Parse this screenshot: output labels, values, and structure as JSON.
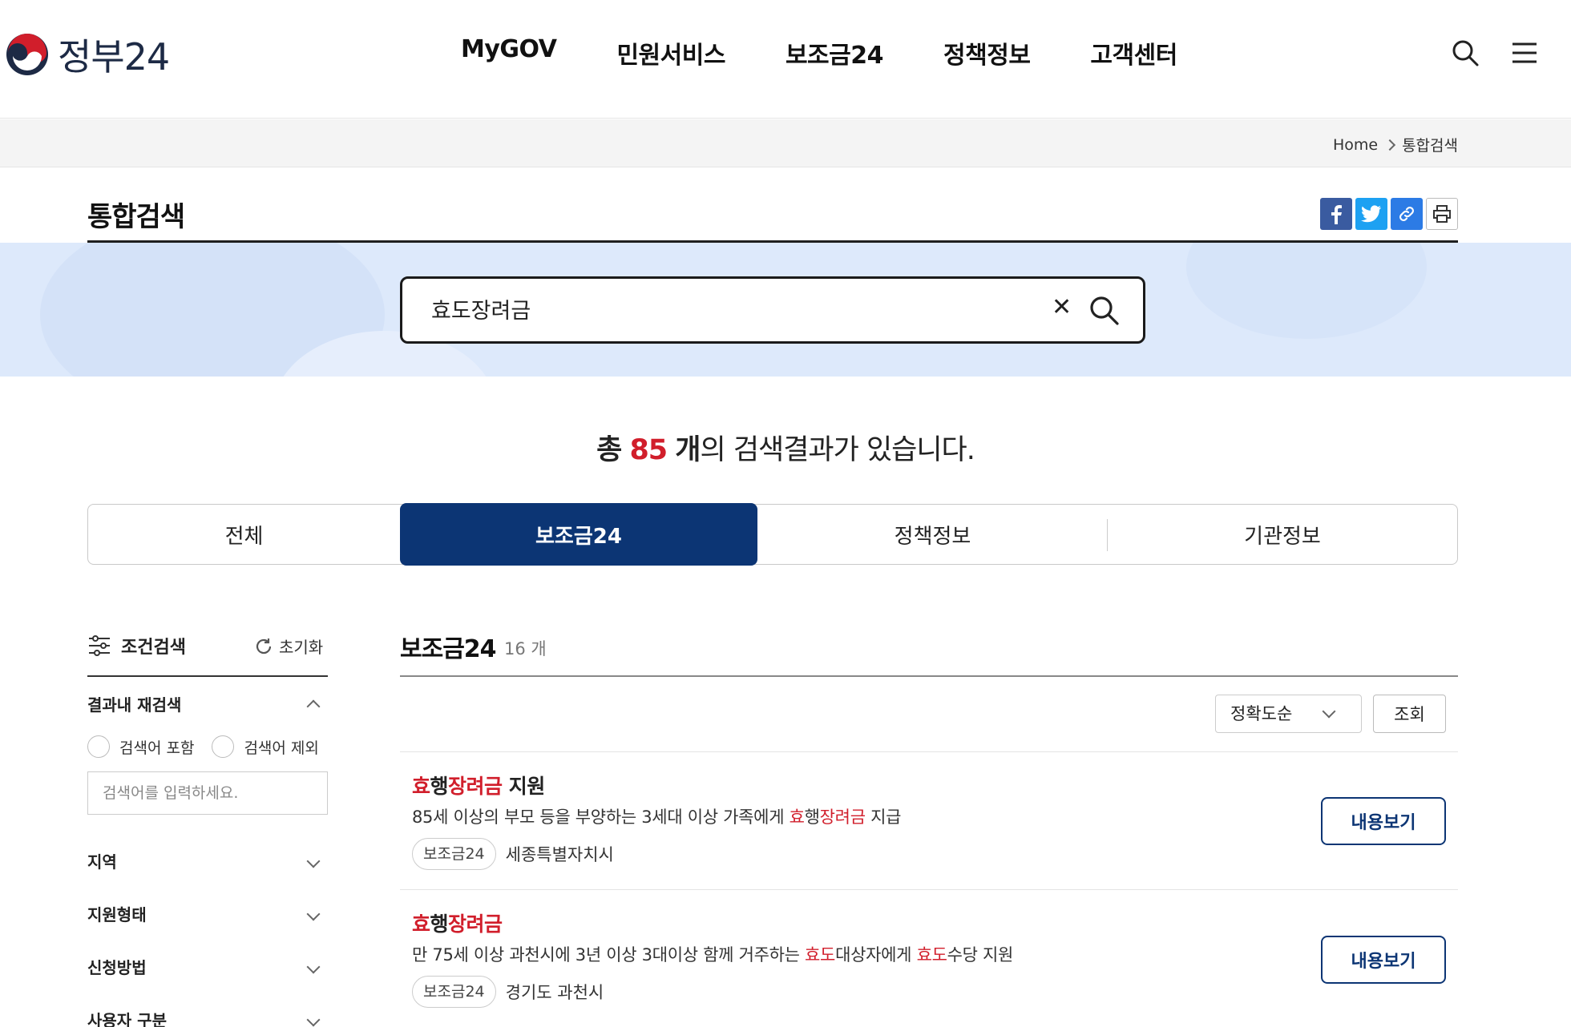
{
  "header": {
    "logo_text": "정부24",
    "nav": [
      "MyGOV",
      "민원서비스",
      "보조금24",
      "정책정보",
      "고객센터"
    ]
  },
  "breadcrumb": {
    "home": "Home",
    "current": "통합검색"
  },
  "page": {
    "title": "통합검색"
  },
  "search": {
    "query": "효도장려금"
  },
  "result_count": {
    "prefix": "총",
    "count": "85",
    "unit": "개",
    "suffix": "의 검색결과가 있습니다."
  },
  "tabs": [
    {
      "label": "전체",
      "active": false
    },
    {
      "label": "보조금24",
      "active": true
    },
    {
      "label": "정책정보",
      "active": false
    },
    {
      "label": "기관정보",
      "active": false
    }
  ],
  "filter": {
    "title": "조건검색",
    "reset": "초기화",
    "refine_title": "결과내 재검색",
    "radio_include": "검색어 포함",
    "radio_exclude": "검색어 제외",
    "refine_placeholder": "검색어를 입력하세요.",
    "sections": [
      "지역",
      "지원형태",
      "신청방법",
      "사용자 구분"
    ]
  },
  "results": {
    "section_title": "보조금24",
    "section_count": "16 개",
    "sort_label": "정확도순",
    "view_button": "조회",
    "detail_button": "내용보기",
    "items": [
      {
        "title_hl1": "효",
        "title_plain1": "행",
        "title_hl2": "장려금",
        "title_plain2": " 지원",
        "desc": [
          "85세 이상의 부모 등을 부양하는 3세대 이상 가족에게 ",
          "효",
          "행",
          "장려금",
          " 지급"
        ],
        "tag": "보조금24",
        "region": "세종특별자치시"
      },
      {
        "title_hl1": "효",
        "title_plain1": "행",
        "title_hl2": "장려금",
        "title_plain2": "",
        "desc": [
          "만 75세 이상 과천시에 3년 이상 3대이상 함께 거주하는 ",
          "효도",
          "대상자에게 ",
          "효도",
          "수당 지원"
        ],
        "tag": "보조금24",
        "region": "경기도 과천시"
      }
    ]
  },
  "colors": {
    "brand_navy": "#0c3574",
    "highlight_red": "#d11e2b",
    "search_band": "#dde9fb"
  }
}
